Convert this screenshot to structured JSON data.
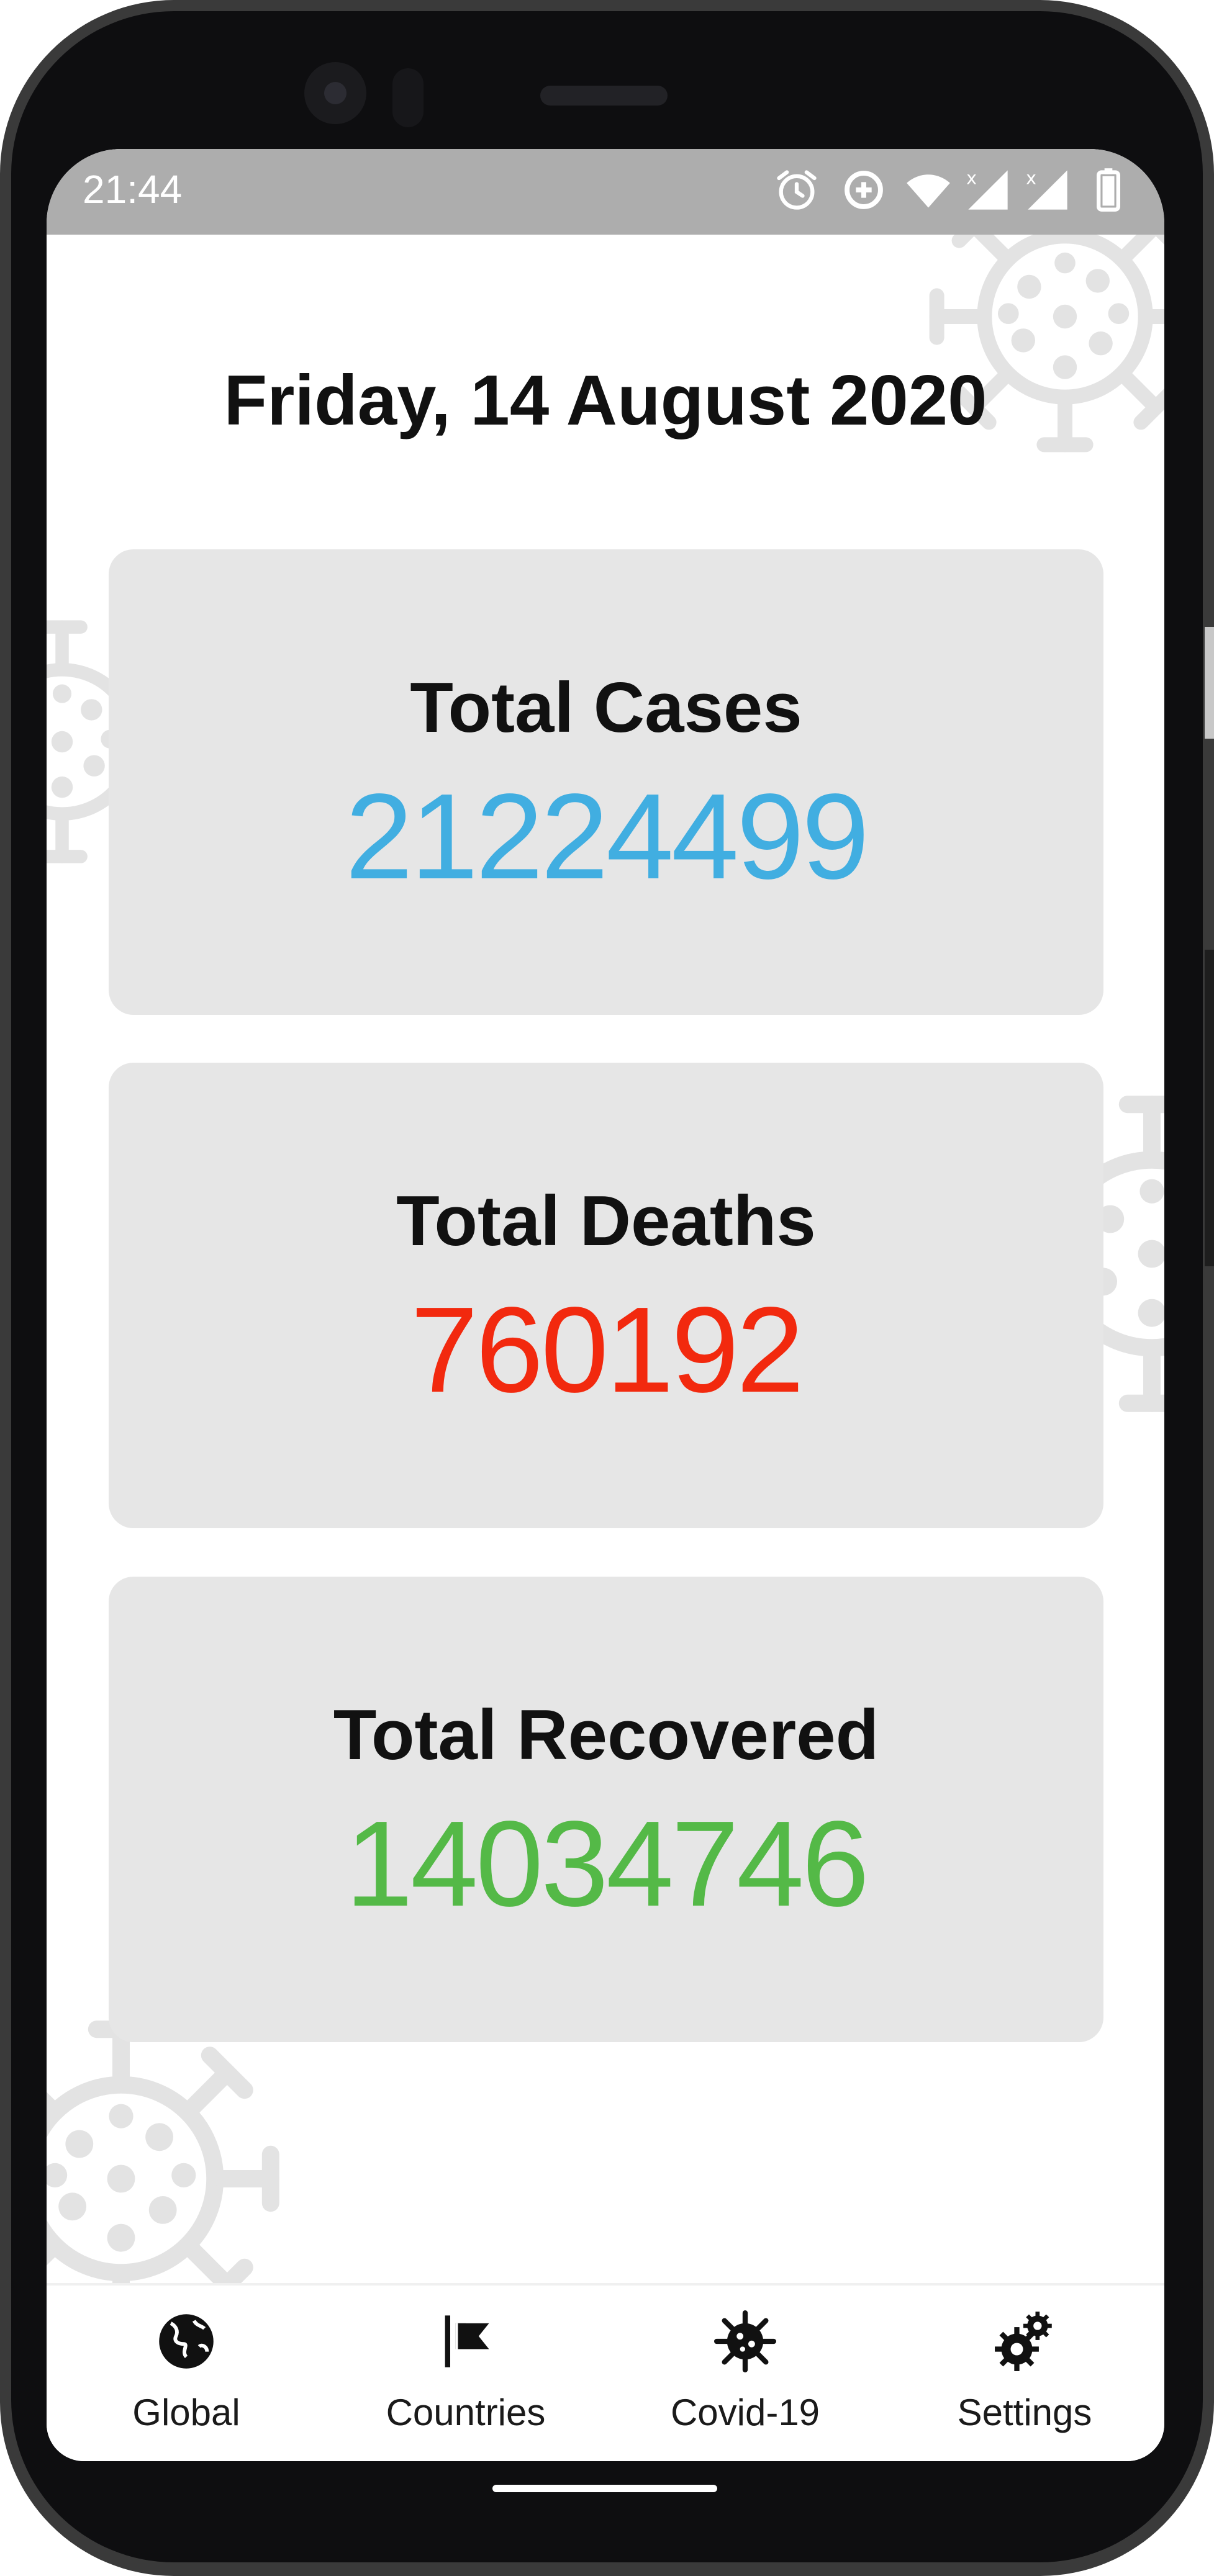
{
  "status_bar": {
    "time": "21:44",
    "icons": [
      "alarm-icon",
      "data-saver-icon",
      "wifi-icon",
      "signal-icon",
      "signal-icon",
      "battery-icon"
    ]
  },
  "date_title": "Friday, 14 August 2020",
  "stats": {
    "cases": {
      "label": "Total Cases",
      "value": "21224499",
      "color": "#41aee1"
    },
    "deaths": {
      "label": "Total Deaths",
      "value": "760192",
      "color": "#f2290e"
    },
    "recovered": {
      "label": "Total Recovered",
      "value": "14034746",
      "color": "#54b947"
    }
  },
  "bottom_nav": {
    "items": [
      {
        "label": "Global",
        "icon": "globe-icon"
      },
      {
        "label": "Countries",
        "icon": "flag-icon"
      },
      {
        "label": "Covid-19",
        "icon": "virus-icon"
      },
      {
        "label": "Settings",
        "icon": "gears-icon"
      }
    ]
  },
  "colors": {
    "background_virus": "#e3e3e3",
    "card_background": "#e6e6e6",
    "status_bar": "#adadad"
  }
}
